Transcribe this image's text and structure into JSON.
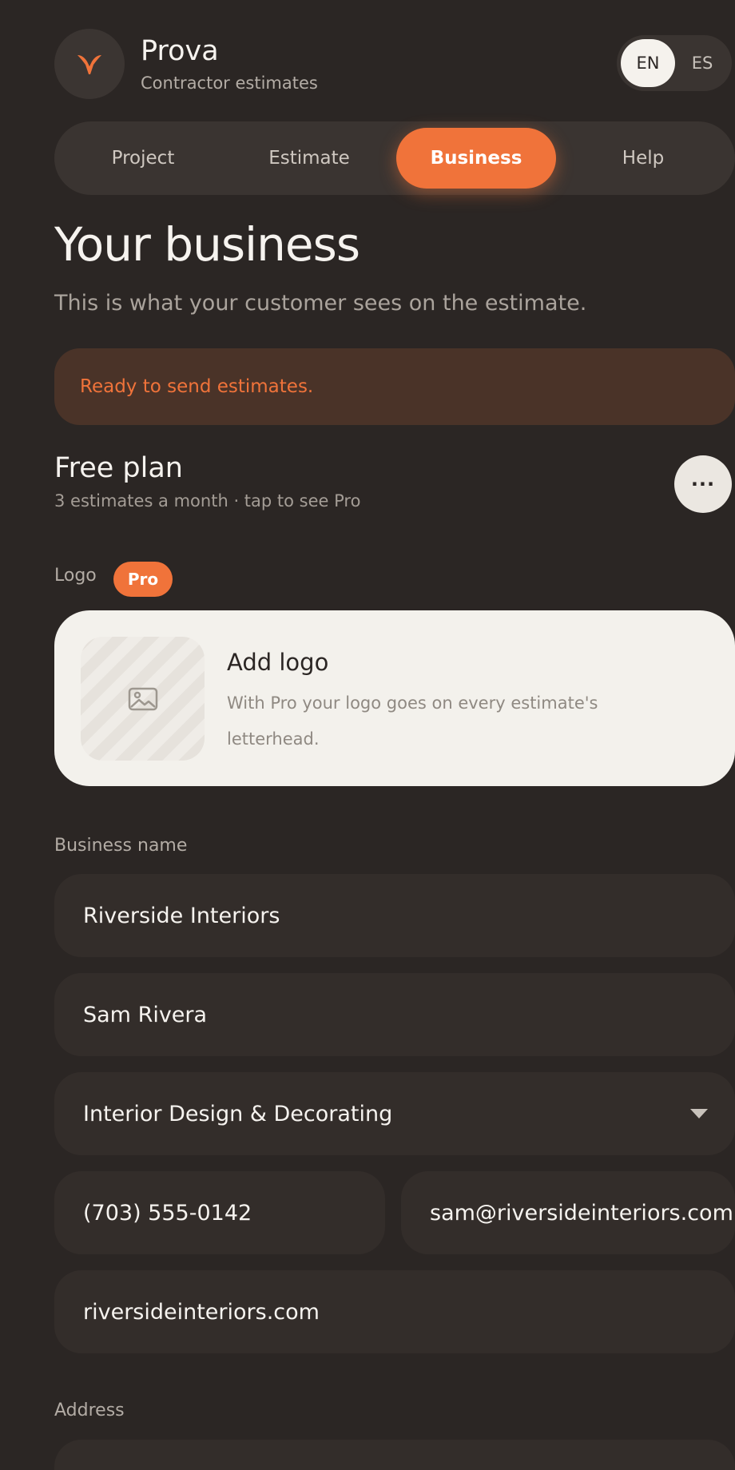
{
  "app": {
    "name": "Prova",
    "subtitle": "Contractor estimates"
  },
  "lang": {
    "en": "EN",
    "es": "ES",
    "selected": "EN"
  },
  "tabs": [
    {
      "label": "Project"
    },
    {
      "label": "Estimate"
    },
    {
      "label": "Business",
      "active": true
    },
    {
      "label": "Help"
    }
  ],
  "page": {
    "title": "Your business",
    "subtitle": "This is what your customer sees on the estimate."
  },
  "status": {
    "message": "Ready to send estimates."
  },
  "plan": {
    "title": "Free plan",
    "subtitle": "3 estimates a month · tap to see Pro",
    "more_label": "···"
  },
  "logo": {
    "label": "Logo",
    "badge": "Pro",
    "card_title": "Add logo",
    "card_desc": "With Pro your logo goes on every estimate's letterhead."
  },
  "business": {
    "section_label": "Business name",
    "name": "Riverside Interiors",
    "contact": "Sam Rivera",
    "trade": "Interior Design & Decorating",
    "phone": "(703) 555-0142",
    "email": "sam@riversideinteriors.com",
    "website": "riversideinteriors.com"
  },
  "address": {
    "label": "Address"
  },
  "colors": {
    "accent": "#f0733a",
    "background": "#2b2624",
    "card": "#f3f1ec",
    "field": "#332d2a"
  }
}
